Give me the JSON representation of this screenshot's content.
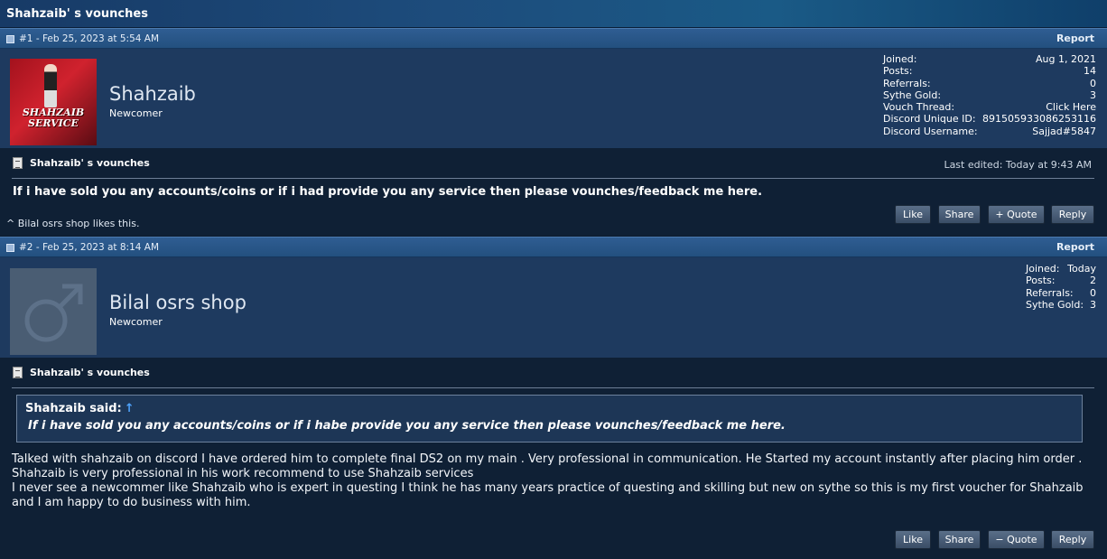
{
  "thread": {
    "title": "Shahzaib' s vounches"
  },
  "posts": [
    {
      "meta": "#1 - Feb 25, 2023 at 5:54 AM",
      "report_label": "Report",
      "avatar_text": "SHAHZAIB SERVICE",
      "username": "Shahzaib",
      "user_title": "Newcomer",
      "stats": [
        {
          "label": "Joined:",
          "value": "Aug 1, 2021"
        },
        {
          "label": "Posts:",
          "value": "14"
        },
        {
          "label": "Referrals:",
          "value": "0"
        },
        {
          "label": "Sythe Gold:",
          "value": "3"
        },
        {
          "label": "Vouch Thread:",
          "value": "Click Here"
        },
        {
          "label": "Discord Unique ID:",
          "value": "891505933086253116"
        },
        {
          "label": "Discord Username:",
          "value": "Sajjad#5847"
        }
      ],
      "post_title": "Shahzaib' s vounches",
      "last_edited": "Last edited: Today at 9:43 AM",
      "message": "If i have sold you any accounts/coins or if i had provide you any service then please vounches/feedback me here.",
      "likes": "^ Bilal osrs shop likes this.",
      "buttons": {
        "like": "Like",
        "share": "Share",
        "quote": "+ Quote",
        "reply": "Reply"
      }
    },
    {
      "meta": "#2 - Feb 25, 2023 at 8:14 AM",
      "report_label": "Report",
      "username": "Bilal osrs shop",
      "user_title": "Newcomer",
      "stats": [
        {
          "label": "Joined:",
          "value": "Today"
        },
        {
          "label": "Posts:",
          "value": "2"
        },
        {
          "label": "Referrals:",
          "value": "0"
        },
        {
          "label": "Sythe Gold:",
          "value": "3"
        }
      ],
      "post_title": "Shahzaib' s vounches",
      "quote": {
        "author": "Shahzaib said:",
        "arrow": "↑",
        "text": "If i have sold you any accounts/coins or if i habe provide you any service then please vounches/feedback me here."
      },
      "message_lines": [
        "Talked with shahzaib on discord I have ordered him to complete final DS2 on my main . Very professional in communication. He Started my account instantly after placing him order .",
        "Shahzaib is very professional in his work recommend to use Shahzaib services",
        "I never see a newcommer like Shahzaib who is expert in questing I think he has many years practice of questing and skilling but new on sythe so this is my first voucher for Shahzaib and I am happy to do business with him."
      ],
      "buttons": {
        "like": "Like",
        "share": "Share",
        "quote": "− Quote",
        "reply": "Reply"
      }
    }
  ]
}
